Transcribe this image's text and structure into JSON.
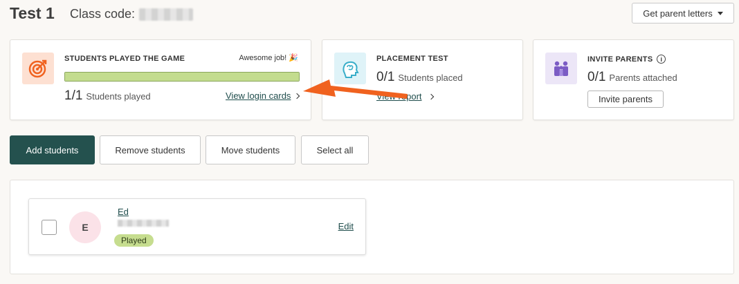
{
  "header": {
    "class_title": "Test 1",
    "class_code_label": "Class code:",
    "parent_letters_label": "Get parent letters"
  },
  "cards": {
    "played": {
      "title": "STUDENTS PLAYED THE GAME",
      "praise": "Awesome job! 🎉",
      "progress": 1.0,
      "count": "1/1",
      "count_label": "Students played",
      "link": "View login cards"
    },
    "placement": {
      "title": "PLACEMENT TEST",
      "count": "0/1",
      "count_label": "Students placed",
      "link": "View report"
    },
    "invite": {
      "title": "INVITE PARENTS",
      "info_glyph": "i",
      "count": "0/1",
      "count_label": "Parents attached",
      "button": "Invite parents"
    }
  },
  "actions": {
    "add": "Add students",
    "remove": "Remove students",
    "move": "Move students",
    "select_all": "Select all"
  },
  "students": [
    {
      "initial": "E",
      "name": "Ed",
      "status": "Played",
      "edit": "Edit"
    }
  ],
  "colors": {
    "primary": "#24514e",
    "progress": "#c3dc8e",
    "annotation_arrow": "#f0621f"
  }
}
